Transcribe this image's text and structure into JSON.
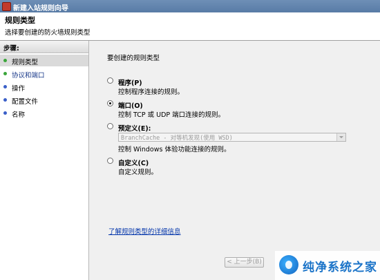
{
  "window": {
    "title": "新建入站规则向导"
  },
  "header": {
    "title": "规则类型",
    "subtitle": "选择要创建的防火墙规则类型"
  },
  "sidebar": {
    "heading": "步骤:",
    "items": [
      {
        "label": "规则类型",
        "bullet_color": "#3aa53a",
        "active": true
      },
      {
        "label": "协议和端口",
        "bullet_color": "#3aa53a",
        "active": false
      },
      {
        "label": "操作",
        "bullet_color": "#3a5fc8",
        "active": false
      },
      {
        "label": "配置文件",
        "bullet_color": "#3a5fc8",
        "active": false
      },
      {
        "label": "名称",
        "bullet_color": "#3a5fc8",
        "active": false
      }
    ]
  },
  "main": {
    "prompt": "要创建的规则类型",
    "options": [
      {
        "title": "程序(P)",
        "desc": "控制程序连接的规则。",
        "checked": false
      },
      {
        "title": "端口(O)",
        "desc": "控制 TCP 或 UDP 端口连接的规则。",
        "checked": true
      },
      {
        "title": "预定义(E):",
        "desc": "控制 Windows 体验功能连接的规则。",
        "checked": false
      },
      {
        "title": "自定义(C)",
        "desc": "自定义规则。",
        "checked": false
      }
    ],
    "predefined_combo": {
      "value": "BranchCache - 对等机发现(使用 WSD)"
    },
    "link": "了解规则类型的详细信息"
  },
  "buttons": {
    "back": "< 上一步(B)"
  },
  "watermark": {
    "text": "纯净系统之家"
  }
}
